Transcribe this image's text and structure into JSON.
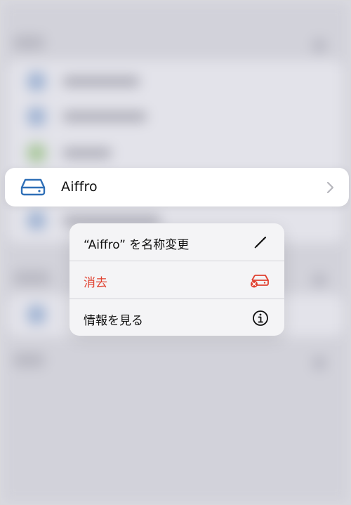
{
  "focused_item": {
    "name": "Aiffro",
    "icon": "drive-icon"
  },
  "context_menu": {
    "items": [
      {
        "label": "“Aiffro” を名称変更",
        "icon": "pencil-icon",
        "destructive": false
      },
      {
        "label": "消去",
        "icon": "drive-delete-icon",
        "destructive": true,
        "color": "#e0402f"
      },
      {
        "label": "情報を見る",
        "icon": "info-icon",
        "destructive": false
      }
    ]
  },
  "colors": {
    "accent": "#2f6fb7",
    "destructive": "#e0402f"
  }
}
